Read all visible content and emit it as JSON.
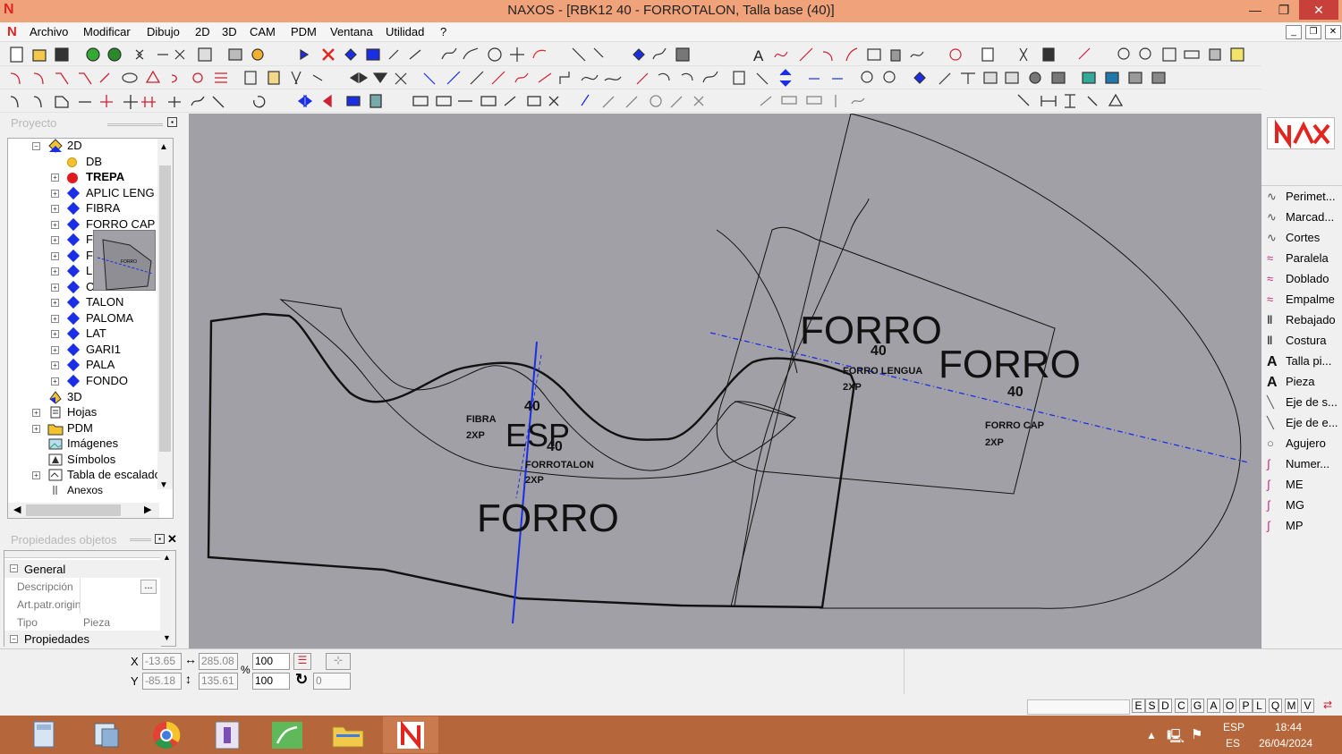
{
  "window": {
    "title": "NAXOS - [RBK12 40 - FORROTALON, Talla base (40)]",
    "minimize": "—",
    "restore": "❐",
    "close": "✕"
  },
  "menu": [
    "Archivo",
    "Modificar",
    "Dibujo",
    "2D",
    "3D",
    "CAM",
    "PDM",
    "Ventana",
    "Utilidad",
    "?"
  ],
  "project": {
    "title": "Proyecto",
    "tree": [
      {
        "label": "2D",
        "level": 0
      },
      {
        "label": "DB",
        "level": 1
      },
      {
        "label": "TREPA",
        "level": 1
      },
      {
        "label": "APLIC LENG",
        "level": 1
      },
      {
        "label": "FIBRA",
        "level": 1
      },
      {
        "label": "FORRO CAP",
        "level": 1
      },
      {
        "label": "F",
        "level": 1
      },
      {
        "label": "F",
        "level": 1
      },
      {
        "label": "L",
        "level": 1
      },
      {
        "label": "C",
        "level": 1
      },
      {
        "label": "TALON",
        "level": 1
      },
      {
        "label": "PALOMA",
        "level": 1
      },
      {
        "label": "LAT",
        "level": 1
      },
      {
        "label": "GARI1",
        "level": 1
      },
      {
        "label": "PALA",
        "level": 1
      },
      {
        "label": "FONDO",
        "level": 1
      },
      {
        "label": "3D",
        "level": 0
      },
      {
        "label": "Hojas",
        "level": 0
      },
      {
        "label": "PDM",
        "level": 0
      },
      {
        "label": "Imágenes",
        "level": 0
      },
      {
        "label": "Símbolos",
        "level": 0
      },
      {
        "label": "Tabla de escalado",
        "level": 0
      },
      {
        "label": "Anexos",
        "level": 0
      }
    ],
    "thumb_text": "FORRO"
  },
  "properties": {
    "title": "Propiedades objetos",
    "section_general": "General",
    "rows": [
      {
        "key": "Descripción",
        "value": ""
      },
      {
        "key": "Art.patr.origin",
        "value": ""
      },
      {
        "key": "Tipo",
        "value": "Pieza"
      }
    ],
    "section_props": "Propiedades",
    "ellipsis": "..."
  },
  "canvas": {
    "labels": {
      "forro_big_main": "FORRO",
      "forro_big_top": "FORRO",
      "forro_big_right": "FORRO",
      "esp": "ESP",
      "n40_a": "40",
      "n40_b": "40",
      "n40_c": "40",
      "n40_d": "40",
      "fibra": "FIBRA",
      "fibra_2xp": "2XP",
      "forrotalon": "FORROTALON",
      "forrotalon_2xp": "2XP",
      "forro_lengua": "FORRO LENGUA",
      "forro_lengua_2xp": "2XP",
      "forro_cap": "FORRO CAP",
      "forro_cap_2xp": "2XP"
    }
  },
  "right_panel": {
    "items": [
      "Perimet...",
      "Marcad...",
      "Cortes",
      "Paralela",
      "Doblado",
      "Empalme",
      "Rebajado",
      "Costura",
      "Talla pi...",
      "Pieza",
      "Eje de s...",
      "Eje de e...",
      "Agujero",
      "Numer...",
      "ME",
      "MG",
      "MP"
    ]
  },
  "status": {
    "x_label": "X",
    "y_label": "Y",
    "x_value": "-13.65",
    "y_value": "-85.18",
    "width_value": "285.08",
    "height_value": "135.61",
    "scale_x": "100",
    "scale_y": "100",
    "percent": "%",
    "rotation": "0",
    "snap_letters": [
      "E",
      "S",
      "D",
      "C",
      "G",
      "A",
      "O",
      "P",
      "L",
      "Q",
      "M",
      "V"
    ]
  },
  "taskbar": {
    "lang_top": "ESP",
    "lang_bottom": "ES",
    "time": "18:44",
    "date": "26/04/2024"
  },
  "colors": {
    "titlebar": "#f0a37a",
    "canvas_bg": "#a1a0a6",
    "taskbar": "#b5663a",
    "accent_red": "#e0261f",
    "dimension_blue": "#1a2ee6"
  }
}
